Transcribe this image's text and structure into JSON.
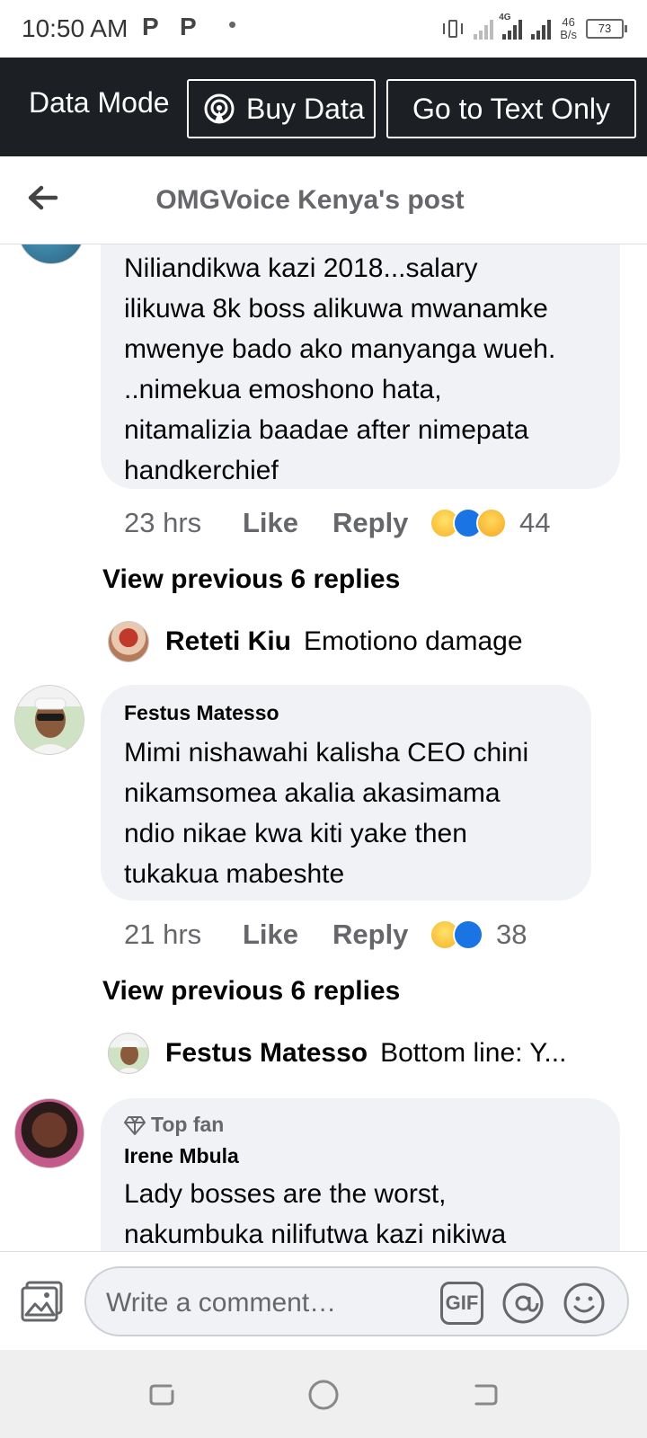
{
  "status_bar": {
    "time": "10:50 AM",
    "notif_1": "P",
    "notif_2": "P",
    "net_type": "4G",
    "speed_value": "46",
    "speed_unit": "B/s",
    "battery": "73"
  },
  "data_bar": {
    "mode_label": "Data Mode",
    "buy_data_label": "Buy Data",
    "text_only_label": "Go to Text Only"
  },
  "header": {
    "title": "OMGVoice Kenya's post"
  },
  "comments": [
    {
      "text_lines": [
        "Niliandikwa kazi 2018...salary",
        "ilikuwa 8k boss alikuwa mwanamke",
        "mwenye bado ako manyanga wueh.",
        "..nimekua emoshono hata,",
        "nitamalizia baadae after nimepata",
        "handkerchief"
      ],
      "time": "23 hrs",
      "like": "Like",
      "reply": "Reply",
      "reaction_count": "44",
      "reactions": [
        "haha-icon",
        "like-icon",
        "care-icon"
      ],
      "view_previous": "View previous 6 replies",
      "latest_reply": {
        "name": "Reteti Kiu",
        "text": "Emotiono damage"
      }
    },
    {
      "author": "Festus Matesso",
      "text_lines": [
        "Mimi nishawahi kalisha CEO chini",
        "nikamsomea akalia akasimama",
        "ndio nikae kwa kiti yake then",
        "tukakua mabeshte"
      ],
      "time": "21 hrs",
      "like": "Like",
      "reply": "Reply",
      "reaction_count": "38",
      "reactions": [
        "haha-icon",
        "like-icon"
      ],
      "view_previous": "View previous 6 replies",
      "latest_reply": {
        "name": "Festus Matesso",
        "text": "Bottom line: Y..."
      }
    },
    {
      "badge": "Top fan",
      "author": "Irene Mbula",
      "text_lines": [
        "Lady bosses are the worst,",
        "nakumbuka nilifutwa kazi nikiwa"
      ]
    }
  ],
  "composer": {
    "placeholder": "Write a comment…",
    "gif_label": "GIF"
  },
  "colors": {
    "data_bar_bg": "#1c2025",
    "bubble_bg": "#f0f2f5",
    "secondary_text": "#65676b",
    "like_blue": "#1b74e4"
  }
}
